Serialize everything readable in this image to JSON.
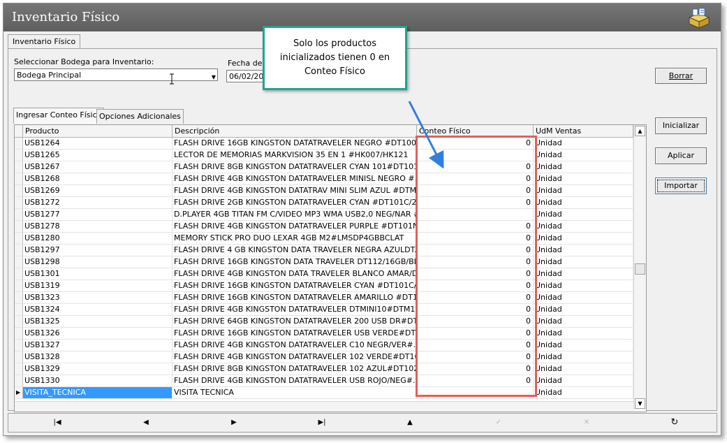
{
  "window": {
    "title": "Inventario Físico"
  },
  "form_tab": "Inventario Físico",
  "bodega": {
    "label": "Seleccionar Bodega para Inventario:",
    "value": "Bodega Principal"
  },
  "fecha": {
    "label": "Fecha de",
    "value": "06/02/20"
  },
  "buttons": {
    "borrar": "Borrar",
    "inicializar": "Inicializar",
    "aplicar": "Aplicar",
    "importar": "Importar"
  },
  "tabs": [
    "Ingresar Conteo Físico",
    "Opciones Adicionales"
  ],
  "grid": {
    "columns": [
      "Producto",
      "Descripción",
      "Conteo Físico",
      "UdM Ventas"
    ],
    "rows": [
      {
        "producto": "USB1264",
        "descripcion": "FLASH DRIVE 16GB KINGSTON DATATRAVELER NEGRO #DT100/...",
        "conteo": "0",
        "udm": "Unidad"
      },
      {
        "producto": "USB1265",
        "descripcion": "LECTOR DE MEMORIAS MARKVISION 35 EN 1 #HK007/HK121",
        "conteo": "",
        "udm": "Unidad"
      },
      {
        "producto": "USB1267",
        "descripcion": "FLASH DRIVE 8GB KINGSTON DATATRAVELER CYAN 101#DT101...",
        "conteo": "0",
        "udm": "Unidad"
      },
      {
        "producto": "USB1268",
        "descripcion": "FLASH DRIVE 4GB KINGSTON DATATRAVELER MINISL NEGRO #...",
        "conteo": "0",
        "udm": "Unidad"
      },
      {
        "producto": "USB1269",
        "descripcion": "FLASH DRIVE 4GB KINGSTON DATATRAV MINI SLIM AZUL #DTM...",
        "conteo": "0",
        "udm": "Unidad"
      },
      {
        "producto": "USB1272",
        "descripcion": "FLASH DRIVE 2GB KINGSTON DATATRAVELER CYAN #DT101C/2...",
        "conteo": "0",
        "udm": "Unidad"
      },
      {
        "producto": "USB1277",
        "descripcion": "D.PLAYER 4GB TITAN FM C/VIDEO MP3 WMA USB2,0 NEG/NAR #...",
        "conteo": "",
        "udm": "Unidad"
      },
      {
        "producto": "USB1278",
        "descripcion": "FLASH DRIVE 4GB KINGSTON DATATRAVELER PURPLE #DT101N...",
        "conteo": "0",
        "udm": "Unidad"
      },
      {
        "producto": "USB1280",
        "descripcion": "MEMORY STICK PRO DUO LEXAR 4GB M2#LMSDP4GBBCLAT",
        "conteo": "0",
        "udm": "Unidad"
      },
      {
        "producto": "USB1297",
        "descripcion": "FLASH DRIVE 4 GB KINGSTON DATA TRAVELER NEGRA AZULDT...",
        "conteo": "0",
        "udm": "Unidad"
      },
      {
        "producto": "USB1298",
        "descripcion": "FLASH DRIVE 16GB KINGSTON DATA TRAVELER DT112/16GB/BL...",
        "conteo": "0",
        "udm": "Unidad"
      },
      {
        "producto": "USB1301",
        "descripcion": "FLASH DRIVE 4GB KINGSTON DATA TRAVELER BLANCO AMAR/D...",
        "conteo": "0",
        "udm": "Unidad"
      },
      {
        "producto": "USB1319",
        "descripcion": "FLASH DRIVE 16GB KINGSTON DATATRAVELER CYAN #DT101C/...",
        "conteo": "0",
        "udm": "Unidad"
      },
      {
        "producto": "USB1323",
        "descripcion": "FLASH DRIVE 16GB KINGSTON DATATRAVELER AMARILLO #DT1...",
        "conteo": "0",
        "udm": "Unidad"
      },
      {
        "producto": "USB1324",
        "descripcion": "FLASH DRIVE 4GB KINGSTON DATATRAVELER DTMINI10#DTM10...",
        "conteo": "0",
        "udm": "Unidad"
      },
      {
        "producto": "USB1325",
        "descripcion": "FLASH DRIVE 64GB KINGSTON DATATRAVELER 200 USB DR#DT...",
        "conteo": "0",
        "udm": "Unidad"
      },
      {
        "producto": "USB1326",
        "descripcion": "FLASH DRIVE 16GB KINGSTON DATATRAVELER USB VERDE#DT...",
        "conteo": "0",
        "udm": "Unidad"
      },
      {
        "producto": "USB1327",
        "descripcion": "FLASH DRIVE 4GB KINGSTON DATATRAVELER C10 NEGR/VER#...",
        "conteo": "0",
        "udm": "Unidad"
      },
      {
        "producto": "USB1328",
        "descripcion": "FLASH DRIVE 4GB KINGSTON DATATRAVELER 102 VERDE#DT10...",
        "conteo": "0",
        "udm": "Unidad"
      },
      {
        "producto": "USB1329",
        "descripcion": "FLASH DRIVE 8GB KINGSTON DATATRAVELER 102 AZUL#DT102/...",
        "conteo": "0",
        "udm": "Unidad"
      },
      {
        "producto": "USB1330",
        "descripcion": "FLASH DRIVE 4GB KINGSTON DATATRAVELER USB ROJO/NEG#...",
        "conteo": "0",
        "udm": "Unidad"
      },
      {
        "producto": "VISITA_TECNICA",
        "descripcion": "VISITA TECNICA",
        "conteo": "",
        "udm": "Unidad",
        "selected": true
      }
    ]
  },
  "navigator": [
    "first-icon",
    "prior-icon",
    "next-icon",
    "last-icon",
    "insert-icon",
    "post-icon",
    "cancel-icon",
    "refresh-icon"
  ],
  "callout": {
    "line1": "Solo los productos",
    "line2": "inicializados tienen 0 en",
    "line3": "Conteo Físico"
  },
  "colors": {
    "titlebar": "#6b6b6b",
    "selection": "#3399ff",
    "callout_border": "#1fa58f",
    "highlight_box": "#e0605a",
    "arrow": "#2f7fe0"
  }
}
